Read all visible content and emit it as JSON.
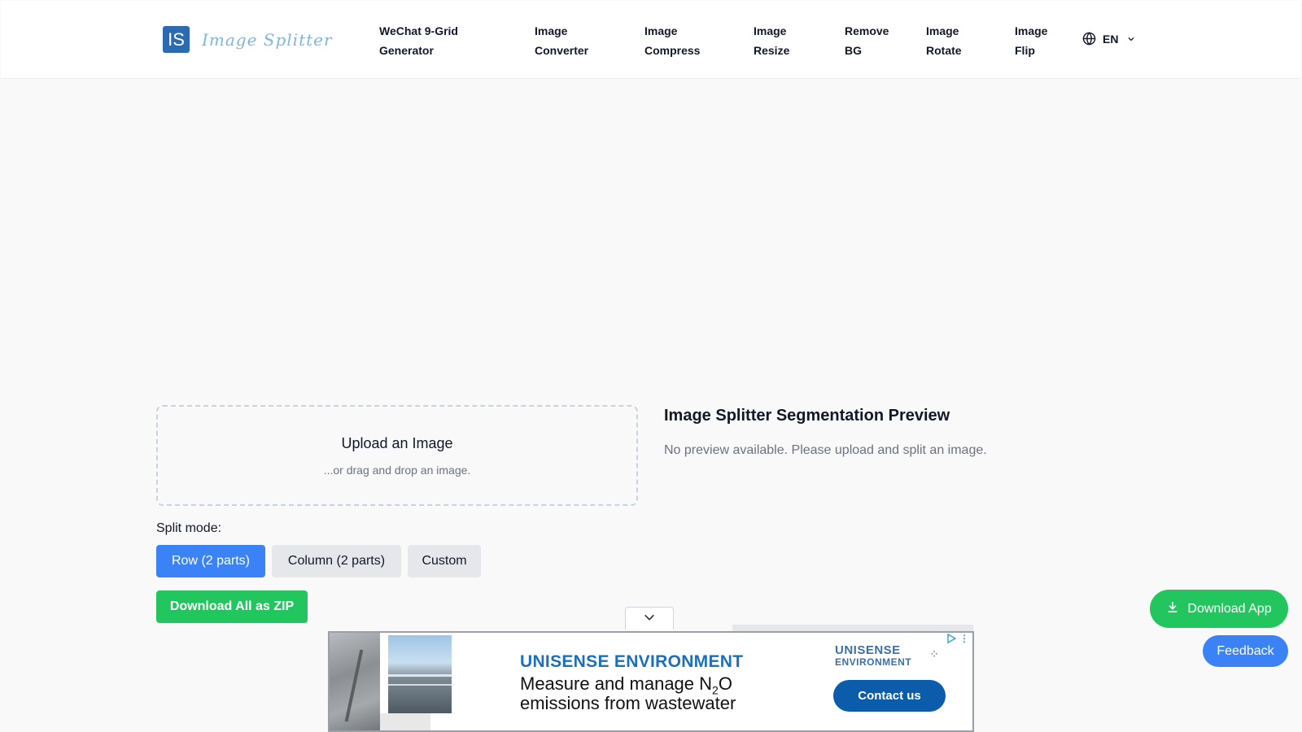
{
  "header": {
    "logo_mark": "IS",
    "logo_text": "Image Splitter",
    "nav": [
      {
        "line1": "WeChat 9-Grid",
        "line2": "Generator"
      },
      {
        "line1": "Image",
        "line2": "Converter"
      },
      {
        "line1": "Image",
        "line2": "Compress"
      },
      {
        "line1": "Image",
        "line2": "Resize"
      },
      {
        "line1": "Remove",
        "line2": "BG"
      },
      {
        "line1": "Image",
        "line2": "Rotate"
      },
      {
        "line1": "Image",
        "line2": "Flip"
      }
    ],
    "language": "EN",
    "icons": {
      "language": "globe-icon",
      "dropdown": "chevron-down-icon"
    }
  },
  "upload": {
    "title": "Upload an Image",
    "subtitle": "...or drag and drop an image."
  },
  "split": {
    "label": "Split mode:",
    "modes": [
      {
        "label": "Row (2 parts)",
        "selected": true
      },
      {
        "label": "Column (2 parts)",
        "selected": false
      },
      {
        "label": "Custom",
        "selected": false
      }
    ],
    "download_zip": "Download All as ZIP"
  },
  "preview": {
    "title": "Image Splitter Segmentation Preview",
    "empty_message": "No preview available. Please upload and split an image."
  },
  "floating": {
    "download_app": "Download App",
    "feedback": "Feedback",
    "download_icon": "download-icon"
  },
  "ad": {
    "brand": "UNISENSE ENVIRONMENT",
    "line1_prefix": "Measure and manage N",
    "line1_sub": "2",
    "line1_suffix": "O",
    "line2": "emissions from wastewater",
    "logo_text_1": "UNISENSE",
    "logo_text_2": "ENVIRONMENT",
    "cta": "Contact us",
    "collapse_icon": "chevron-down-icon",
    "adchoices_icon": "adchoices-icon"
  },
  "colors": {
    "primary_blue": "#3b82f6",
    "success_green": "#22c55e",
    "logo_blue": "#2c6bb0",
    "ad_blue": "#0b5cab"
  }
}
